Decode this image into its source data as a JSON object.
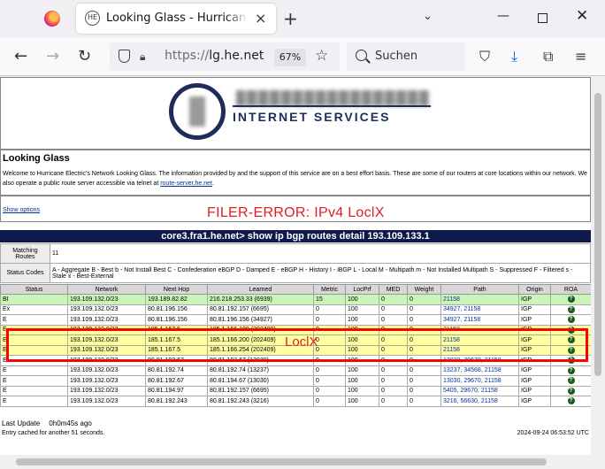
{
  "browser": {
    "tab_title": "Looking Glass - Hurricane Electric",
    "tab_favicon": "HE",
    "url_proto": "https://",
    "url_host": "lg.he.net",
    "zoom": "67%",
    "search_placeholder": "Suchen",
    "icons": [
      "firefox-icon",
      "back-icon",
      "forward-icon",
      "reload-icon",
      "shield-icon",
      "lock-icon",
      "star-icon",
      "search-icon",
      "pocket-icon",
      "download-icon",
      "extensions-icon",
      "menu-icon"
    ],
    "accent": "#0061e0"
  },
  "header": {
    "logo_text": "INTERNET SERVICES"
  },
  "looking_glass": {
    "title": "Looking Glass",
    "desc_1": "Welcome to Hurricane Electric's Network Looking Glass. The information provided by and the support of this service are on a best effort basis. These are some of our routers at core locations within our network. We also operate a public route server accessible via telnet at ",
    "desc_link": "route-server.he.net",
    "desc_2": ".",
    "show_options": "Show options"
  },
  "annotations": {
    "filer_error": "FILER-ERROR: IPv4 LoclX",
    "loclx": "LoclX",
    "color": "#e02020"
  },
  "command": "core3.fra1.he.net> show ip bgp routes detail 193.109.133.1",
  "meta": {
    "matching_label": "Matching Routes",
    "matching_value": "11",
    "status_label": "Status Codes",
    "status_value": "A - Aggregate B - Best b - Not Install Best C - Confederation eBGP D - Damped E - eBGP H - History I - iBGP L - Local M - Multipath m - Not Installed Multipath S - Suppressed F - Filtered s - Stale x - Best-External"
  },
  "table": {
    "columns": [
      "Status",
      "Network",
      "Next Hop",
      "Learned",
      "Metric",
      "LocPrf",
      "MED",
      "Weight",
      "Path",
      "Origin",
      "ROA"
    ],
    "rows": [
      {
        "style": "best",
        "cells": [
          "BI",
          "193.109.132.0/23",
          "193.189.82.82",
          "216.218.253.33 (6939)",
          "15",
          "100",
          "0",
          "0",
          "21158",
          "IGP"
        ]
      },
      {
        "style": "",
        "cells": [
          "Ex",
          "193.109.132.0/23",
          "80.81.196.156",
          "80.81.192.157 (6695)",
          "0",
          "100",
          "0",
          "0",
          "34927, 21158",
          "IGP"
        ]
      },
      {
        "style": "",
        "cells": [
          "E",
          "193.109.132.0/23",
          "80.81.196.156",
          "80.81.196.156 (34927)",
          "0",
          "100",
          "0",
          "0",
          "34927, 21158",
          "IGP"
        ]
      },
      {
        "style": "hl",
        "cells": [
          "E",
          "193.109.132.0/23",
          "185.1.167.5",
          "185.1.166.100 (202409)",
          "0",
          "100",
          "0",
          "0",
          "21158",
          "IGP"
        ]
      },
      {
        "style": "hl",
        "cells": [
          "E",
          "193.109.132.0/23",
          "185.1.167.5",
          "185.1.166.200 (202409)",
          "0",
          "100",
          "0",
          "0",
          "21158",
          "IGP"
        ]
      },
      {
        "style": "hl",
        "cells": [
          "E",
          "193.109.132.0/23",
          "185.1.167.5",
          "185.1.166.254 (202409)",
          "0",
          "100",
          "0",
          "0",
          "21158",
          "IGP"
        ]
      },
      {
        "style": "",
        "cells": [
          "E",
          "193.109.132.0/23",
          "80.81.192.67",
          "80.81.192.67 (13030)",
          "0",
          "100",
          "0",
          "0",
          "13030, 29670, 21158",
          "IGP"
        ]
      },
      {
        "style": "",
        "cells": [
          "E",
          "193.109.132.0/23",
          "80.81.192.74",
          "80.81.192.74 (13237)",
          "0",
          "100",
          "0",
          "0",
          "13237, 34568, 21158",
          "IGP"
        ]
      },
      {
        "style": "",
        "cells": [
          "E",
          "193.109.132.0/23",
          "80.81.192.67",
          "80.81.194.67 (13030)",
          "0",
          "100",
          "0",
          "0",
          "13030, 29670, 21158",
          "IGP"
        ]
      },
      {
        "style": "",
        "cells": [
          "E",
          "193.109.132.0/23",
          "80.81.194.97",
          "80.81.192.157 (6695)",
          "0",
          "100",
          "0",
          "0",
          "5405, 29670, 21158",
          "IGP"
        ]
      },
      {
        "style": "",
        "cells": [
          "E",
          "193.109.132.0/23",
          "80.81.192.243",
          "80.81.192.243 (3216)",
          "0",
          "100",
          "0",
          "0",
          "3216, 56630, 21158",
          "IGP"
        ]
      }
    ]
  },
  "footer": {
    "last_update_label": "Last Update",
    "last_update_value": "0h0m45s ago",
    "cache_note": "Entry cached for another 51 seconds.",
    "timestamp": "2024-09-24 06:53:52 UTC"
  }
}
